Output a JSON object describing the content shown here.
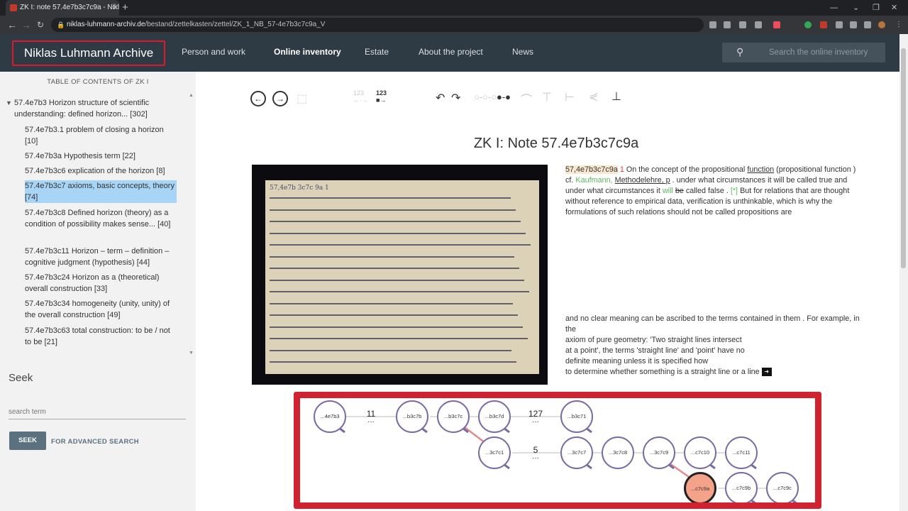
{
  "browser": {
    "tab_title": "ZK I: note 57.4e7b3c7c9a - Nikla",
    "url_host": "niklas-luhmann-archiv.de",
    "url_path": "/bestand/zettelkasten/zettel/ZK_1_NB_57-4e7b3c7c9a_V"
  },
  "header": {
    "logo": "Niklas Luhmann Archive",
    "nav": [
      "Person and work",
      "Online inventory",
      "Estate",
      "About the project",
      "News"
    ],
    "search_placeholder": "Search the online inventory"
  },
  "sidebar": {
    "toc_title": "TABLE OF CONTENTS OF ZK I",
    "parent": "57.4e7b3 Horizon structure of scientific understanding: defined horizon... [302]",
    "items": [
      "57.4e7b3.1 problem of closing a horizon [10]",
      "57.4e7b3a Hypothesis term [22]",
      "57.4e7b3c6 explication of the horizon [8]",
      "57.4e7b3c7 axioms, basic concepts, theory [74]",
      "57.4e7b3c8 Defined horizon (theory) as a condition of possibility makes sense... [40]",
      "57.4e7b3c11 Horizon – term – definition – cognitive judgment (hypothesis) [44]",
      "57.4e7b3c24 Horizon as a (theoretical) overall construction [33]",
      "57.4e7b3c34 homogeneity (unity, unity) of the overall construction [49]",
      "57.4e7b3c63 total construction: to be / not to be [21]"
    ],
    "seek_title": "Seek",
    "seek_placeholder": "search term",
    "seek_button": "SEEK",
    "advanced_link": "FOR ADVANCED SEARCH"
  },
  "toolbar": {
    "num_dim": "123",
    "num_active": "123"
  },
  "note": {
    "title": "ZK I: Note 57.4e7b3c7c9a",
    "id_label": "57,4e7b3c7c9a",
    "num": "1",
    "t1": "On the concept of the propositional",
    "t1_link": "function",
    "t2": "(propositional function ) cf.",
    "t2_green": "Kaufmann,",
    "t2_link": "Methodelehre, p",
    "t3": ". under what circumstances it will be called true and under what circumstances it",
    "t3_green": "will",
    "t3_strike": "be",
    "t4": "called false .",
    "t4_green": "[*]",
    "t5": "But for relations that are thought without reference to empirical data, verification is unthinkable, which is why the formulations of such relations should not be called propositions are",
    "p2_a": "and no clear meaning can be ascribed to the terms contained in them . For example, in the",
    "p2_b": "axiom of pure geometry: 'Two straight lines intersect",
    "p2_c": "at a point', the terms 'straight line' and 'point' have no",
    "p2_d": "definite meaning unless it is specified how",
    "p2_e": "to determine whether something is a straight line or a line",
    "scan_header": "57,4e7b 3c7c 9a 1"
  },
  "graph": {
    "row1": [
      "...4e7b3",
      "...b3c7b",
      "...b3c7c",
      "...b3c7d",
      "...b3c71"
    ],
    "gap1": "11",
    "gap2": "127",
    "row2": [
      "...3c7c1",
      "...3c7c7",
      "...3c7c8",
      "...3c7c9",
      "...c7c10",
      "...c7c11"
    ],
    "gap3": "5",
    "row3": [
      "...c7c9a",
      "...c7c9b",
      "...c7c9c"
    ]
  },
  "colors": {
    "header_bg": "#2f3b44",
    "highlight": "#a8d4f5",
    "annotation_red": "#d0232f",
    "active_node": "#f4a28a"
  }
}
